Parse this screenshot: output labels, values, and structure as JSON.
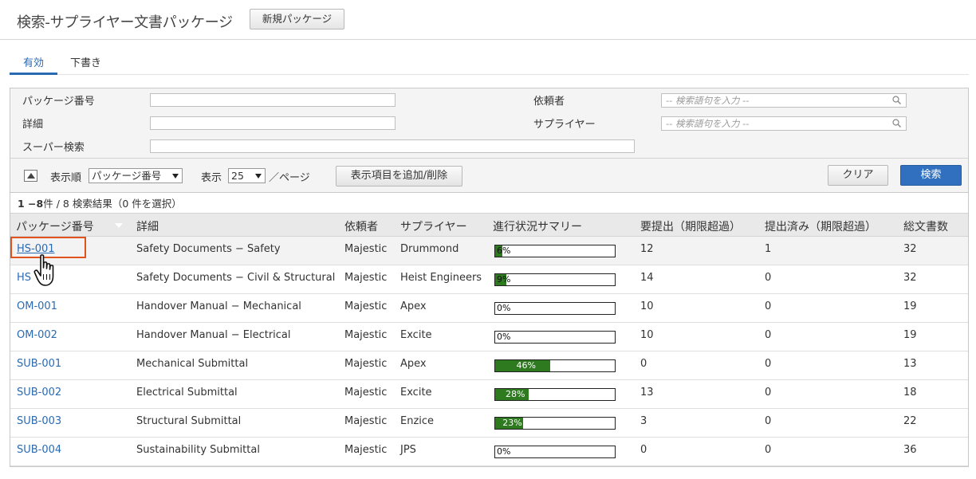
{
  "header": {
    "title": "検索-サプライヤー文書パッケージ",
    "new_button": "新規パッケージ"
  },
  "tabs": [
    {
      "label": "有効",
      "active": true
    },
    {
      "label": "下書き",
      "active": false
    }
  ],
  "filters": {
    "package_number_label": "パッケージ番号",
    "detail_label": "詳細",
    "super_search_label": "スーパー検索",
    "requester_label": "依頼者",
    "supplier_label": "サプライヤー",
    "requester_placeholder": "-- 検索語句を入力 --",
    "supplier_placeholder": "-- 検索語句を入力 --"
  },
  "toolbar": {
    "sort_order_label": "表示順",
    "sort_value": "パッケージ番号",
    "display_label": "表示",
    "per_page_value": "25",
    "per_page_suffix": "／ページ",
    "columns_button": "表示項目を追加/削除",
    "clear_button": "クリア",
    "search_button": "検索"
  },
  "results": {
    "range": "1 −8",
    "count_text": "件 / 8 検索結果",
    "selected_text": "（0 件を選択）"
  },
  "columns": [
    "パッケージ番号",
    "詳細",
    "依頼者",
    "サプライヤー",
    "進行状況サマリー",
    "要提出（期限超過）",
    "提出済み（期限超過）",
    "総文書数"
  ],
  "rows": [
    {
      "id": "HS-001",
      "detail": "Safety Documents − Safety",
      "requester": "Majestic",
      "supplier": "Drummond",
      "progress": 6,
      "progress_label": "6%",
      "required": "12",
      "submitted": "1",
      "total": "32"
    },
    {
      "id": "HS",
      "detail": "Safety Documents − Civil & Structural",
      "requester": "Majestic",
      "supplier": "Heist Engineers",
      "progress": 9,
      "progress_label": "9%",
      "required": "14",
      "submitted": "0",
      "total": "32"
    },
    {
      "id": "OM-001",
      "detail": "Handover Manual − Mechanical",
      "requester": "Majestic",
      "supplier": "Apex",
      "progress": 0,
      "progress_label": "0%",
      "required": "10",
      "submitted": "0",
      "total": "19"
    },
    {
      "id": "OM-002",
      "detail": "Handover Manual − Electrical",
      "requester": "Majestic",
      "supplier": "Excite",
      "progress": 0,
      "progress_label": "0%",
      "required": "10",
      "submitted": "0",
      "total": "19"
    },
    {
      "id": "SUB-001",
      "detail": "Mechanical Submittal",
      "requester": "Majestic",
      "supplier": "Apex",
      "progress": 46,
      "progress_label": "46%",
      "required": "0",
      "submitted": "0",
      "total": "13"
    },
    {
      "id": "SUB-002",
      "detail": "Electrical Submittal",
      "requester": "Majestic",
      "supplier": "Excite",
      "progress": 28,
      "progress_label": "28%",
      "required": "13",
      "submitted": "0",
      "total": "18"
    },
    {
      "id": "SUB-003",
      "detail": "Structural Submittal",
      "requester": "Majestic",
      "supplier": "Enzice",
      "progress": 23,
      "progress_label": "23%",
      "required": "3",
      "submitted": "0",
      "total": "22"
    },
    {
      "id": "SUB-004",
      "detail": "Sustainability Submittal",
      "requester": "Majestic",
      "supplier": "JPS",
      "progress": 0,
      "progress_label": "0%",
      "required": "0",
      "submitted": "0",
      "total": "36"
    }
  ],
  "colors": {
    "accent": "#2a6ab3",
    "progress_fill": "#2d7a1f",
    "highlight": "#e0531f",
    "primary_button": "#3170bf"
  }
}
